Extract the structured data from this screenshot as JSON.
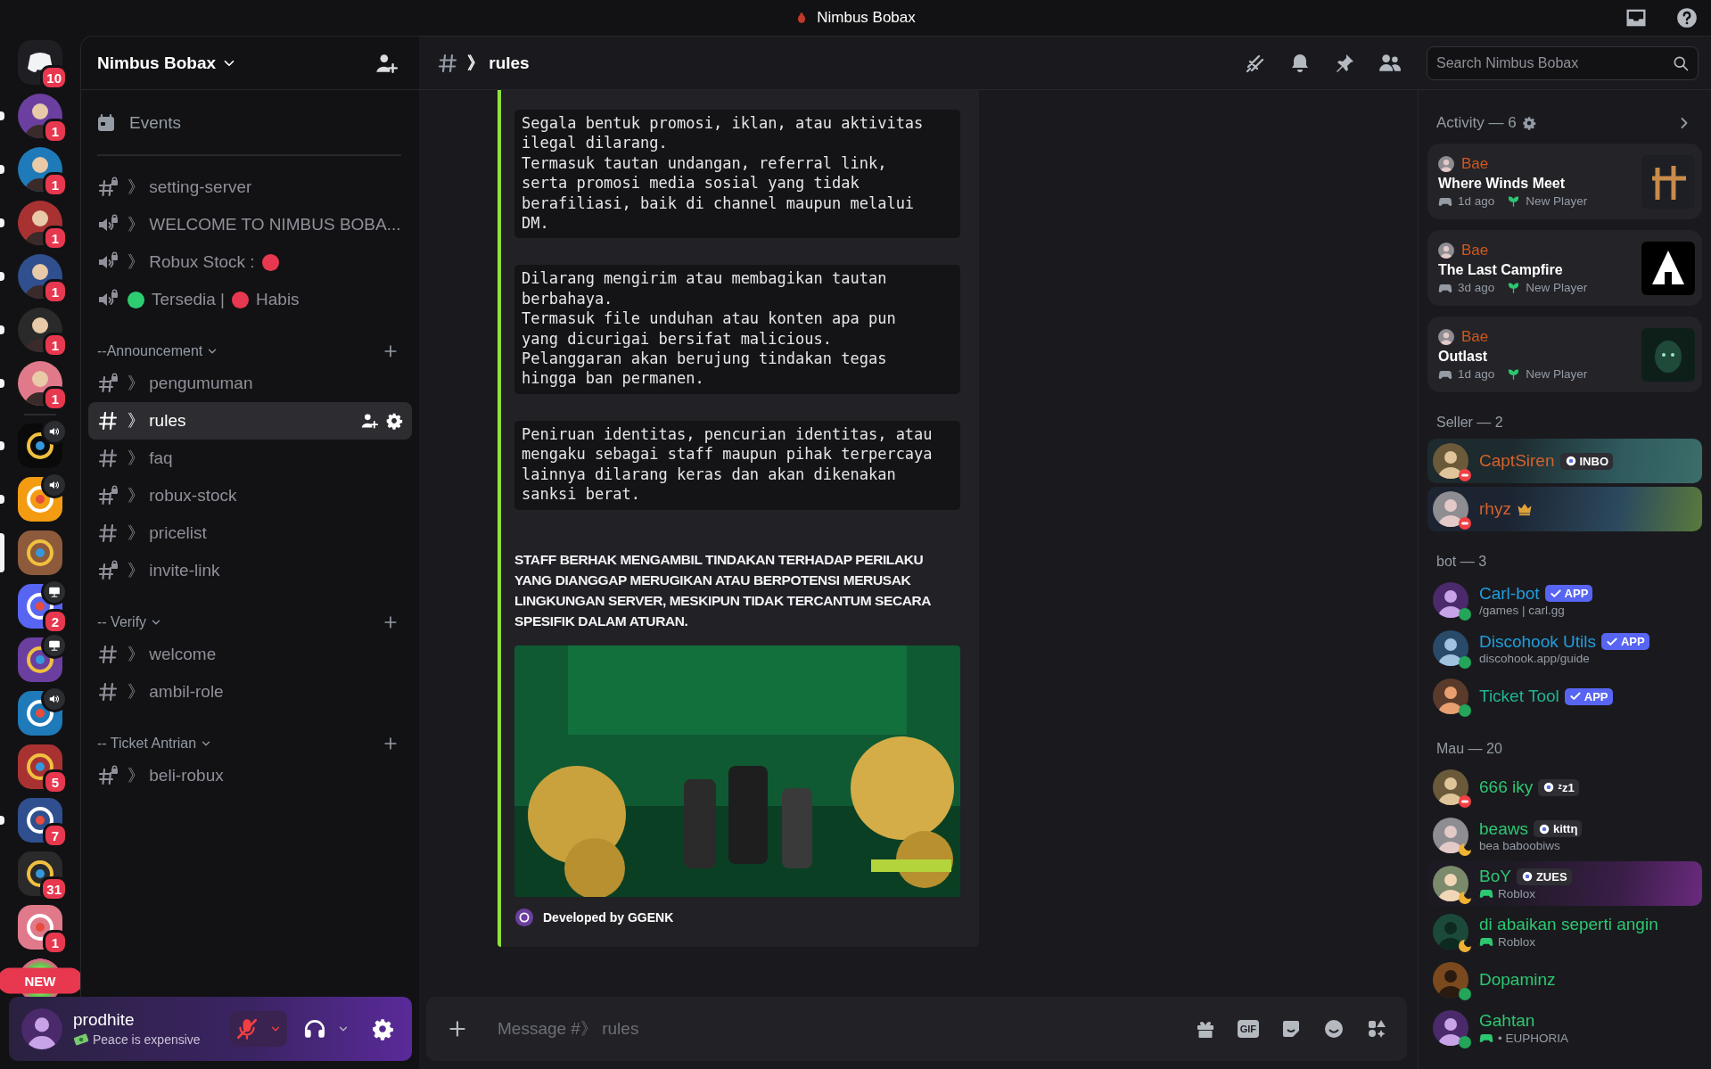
{
  "title_bar": {
    "title": "Nimbus Bobax"
  },
  "servers": [
    {
      "kind": "home",
      "badge": "10",
      "voice": false,
      "streaming": false,
      "unread": false,
      "selected": false
    },
    {
      "kind": "avatar",
      "badge": "1",
      "voice": false,
      "streaming": false,
      "unread": true,
      "selected": false
    },
    {
      "kind": "avatar",
      "badge": "1",
      "voice": false,
      "streaming": false,
      "unread": true,
      "selected": false
    },
    {
      "kind": "avatar",
      "badge": "1",
      "voice": false,
      "streaming": false,
      "unread": true,
      "selected": false
    },
    {
      "kind": "avatar",
      "badge": "1",
      "voice": false,
      "streaming": false,
      "unread": true,
      "selected": false
    },
    {
      "kind": "avatar",
      "badge": "1",
      "voice": false,
      "streaming": false,
      "unread": true,
      "selected": false
    },
    {
      "kind": "avatar",
      "badge": "1",
      "voice": false,
      "streaming": false,
      "unread": true,
      "selected": false
    },
    {
      "kind": "divider"
    },
    {
      "kind": "app",
      "voice": true,
      "streaming": false,
      "unread": true,
      "selected": false
    },
    {
      "kind": "app",
      "voice": true,
      "streaming": false,
      "unread": true,
      "selected": false
    },
    {
      "kind": "app",
      "voice": false,
      "streaming": false,
      "unread": false,
      "selected": true
    },
    {
      "kind": "app",
      "badge": "2",
      "voice": false,
      "streaming": true,
      "unread": false,
      "selected": false
    },
    {
      "kind": "app",
      "voice": false,
      "streaming": true,
      "unread": false,
      "selected": false
    },
    {
      "kind": "app",
      "voice": true,
      "streaming": false,
      "unread": false,
      "selected": false
    },
    {
      "kind": "app",
      "badge": "5",
      "voice": false,
      "streaming": false,
      "unread": false,
      "selected": false
    },
    {
      "kind": "app",
      "badge": "7",
      "voice": false,
      "streaming": false,
      "unread": true,
      "selected": false
    },
    {
      "kind": "app",
      "badge": "31",
      "voice": false,
      "streaming": false,
      "unread": false,
      "selected": false
    },
    {
      "kind": "app",
      "badge": "1",
      "voice": false,
      "streaming": false,
      "unread": false,
      "selected": false
    },
    {
      "kind": "avatar",
      "label": "NEW",
      "voice": false,
      "streaming": false,
      "unread": false,
      "selected": false
    }
  ],
  "sidebar": {
    "server_name": "Nimbus Bobax",
    "events_label": "Events",
    "channels": [
      {
        "kind": "text-locked",
        "parts": [
          {
            "text": "》 setting-server"
          }
        ],
        "selected": false
      },
      {
        "kind": "voice-locked",
        "parts": [
          {
            "text": "》 WELCOME TO NIMBUS BOBA..."
          }
        ],
        "selected": false
      },
      {
        "kind": "voice-locked",
        "parts": [
          {
            "text": "》 Robux Stock :"
          },
          {
            "color": "#e8384f"
          }
        ],
        "selected": false
      },
      {
        "kind": "voice-locked",
        "parts": [
          {
            "color": "#2ecc71"
          },
          {
            "text": "Tersedia |"
          },
          {
            "color": "#e8384f"
          },
          {
            "text": "Habis"
          }
        ],
        "selected": false
      }
    ],
    "categories": [
      {
        "name": "--Announcement",
        "expanded": true,
        "channels": [
          {
            "kind": "text-locked",
            "parts": [
              {
                "text": "》 pengumuman"
              }
            ],
            "selected": false
          },
          {
            "kind": "text",
            "parts": [
              {
                "text": "》 rules"
              }
            ],
            "selected": true
          },
          {
            "kind": "text",
            "parts": [
              {
                "text": "》 faq"
              }
            ],
            "selected": false
          },
          {
            "kind": "text-locked",
            "parts": [
              {
                "text": "》 robux-stock"
              }
            ],
            "selected": false
          },
          {
            "kind": "text",
            "parts": [
              {
                "text": "》 pricelist"
              }
            ],
            "selected": false
          },
          {
            "kind": "text-locked",
            "parts": [
              {
                "text": "》 invite-link"
              }
            ],
            "selected": false
          }
        ]
      },
      {
        "name": "-- Verify",
        "expanded": true,
        "channels": [
          {
            "kind": "text",
            "parts": [
              {
                "text": "》 welcome"
              }
            ],
            "selected": false
          },
          {
            "kind": "text",
            "parts": [
              {
                "text": "》 ambil-role"
              }
            ],
            "selected": false
          }
        ]
      },
      {
        "name": "-- Ticket Antrian",
        "expanded": true,
        "channels": [
          {
            "kind": "text-locked",
            "parts": [
              {
                "text": "》 beli-robux"
              }
            ],
            "selected": false
          }
        ]
      }
    ]
  },
  "user_panel": {
    "username": "prodhite",
    "status": "Peace is expensive",
    "muted": true,
    "deafened": false
  },
  "chat": {
    "channel_name": "》 rules",
    "search_placeholder": "Search Nimbus Bobax",
    "embed": {
      "code_blocks": [
        "Segala bentuk promosi, iklan, atau aktivitas ilegal dilarang.\nTermasuk tautan undangan, referral link, serta promosi media sosial yang tidak berafiliasi, baik di channel maupun melalui DM.",
        "Dilarang mengirim atau membagikan tautan berbahaya.\nTermasuk file unduhan atau konten apa pun yang dicurigai bersifat malicious.\nPelanggaran akan berujung tindakan tegas hingga ban permanen.",
        "Peniruan identitas, pencurian identitas, atau mengaku sebagai staff maupun pihak terpercaya lainnya dilarang keras dan akan dikenakan sanksi berat."
      ],
      "notice": "STAFF BERHAK MENGAMBIL TINDAKAN TERHADAP PERILAKU YANG DIANGGAP MERUGIKAN ATAU BERPOTENSI MERUSAK LINGKUNGAN SERVER, MESKIPUN TIDAK TERCANTUM SECARA SPESIFIK DALAM ATURAN.",
      "footer": "Developed by GGENK"
    },
    "composer": {
      "placeholder": "Message #》 rules",
      "gif_label": "GIF"
    }
  },
  "members": {
    "activity": {
      "title": "Activity — 6",
      "items": [
        {
          "user": "Bae",
          "game": "Where Winds Meet",
          "time": "1d ago",
          "tag": "New Player"
        },
        {
          "user": "Bae",
          "game": "The Last Campfire",
          "time": "3d ago",
          "tag": "New Player"
        },
        {
          "user": "Bae",
          "game": "Outlast",
          "time": "1d ago",
          "tag": "New Player"
        }
      ]
    },
    "groups": [
      {
        "title": "Seller — 2",
        "members": [
          {
            "name": "CaptSiren",
            "color": "#d5622b",
            "tag": {
              "kind": "guild",
              "text": "INBO"
            },
            "dnd": true,
            "idle": false,
            "banner": true,
            "crown": false,
            "playing": false
          },
          {
            "name": "rhyz",
            "color": "#d5622b",
            "dnd": true,
            "idle": false,
            "banner": true,
            "crown": true,
            "playing": false
          }
        ]
      },
      {
        "title": "bot — 3",
        "members": [
          {
            "name": "Carl-bot",
            "color": "#1f9ede",
            "tag": {
              "kind": "app",
              "text": "APP"
            },
            "subtitle": "/games | carl.gg",
            "dnd": false,
            "idle": false,
            "banner": false,
            "crown": false,
            "playing": false
          },
          {
            "name": "Discohook Utils",
            "color": "#1f9ede",
            "tag": {
              "kind": "app",
              "text": "APP"
            },
            "subtitle": "discohook.app/guide",
            "dnd": false,
            "idle": false,
            "banner": false,
            "crown": false,
            "playing": false
          },
          {
            "name": "Ticket Tool",
            "color": "#1fb594",
            "tag": {
              "kind": "app",
              "text": "APP"
            },
            "dnd": false,
            "idle": false,
            "banner": false,
            "crown": false,
            "playing": false
          }
        ]
      },
      {
        "title": "Mau — 20",
        "members": [
          {
            "name": "666 iky",
            "color": "#2dc771",
            "tag": {
              "kind": "guild",
              "text": "ᶻz1"
            },
            "dnd": true,
            "idle": false,
            "banner": false,
            "crown": false,
            "playing": false
          },
          {
            "name": "beaws",
            "color": "#2dc771",
            "tag": {
              "kind": "guild",
              "text": "kittη"
            },
            "subtitle": "bea baboobiws",
            "dnd": false,
            "idle": true,
            "banner": false,
            "crown": false,
            "playing": false
          },
          {
            "name": "BoY",
            "color": "#2dc771",
            "tag": {
              "kind": "guild",
              "text": "ZUES"
            },
            "subtitle": "Roblox",
            "dnd": false,
            "idle": true,
            "banner": true,
            "crown": false,
            "playing": true
          },
          {
            "name": "di abaikan seperti angin",
            "color": "#2dc771",
            "subtitle": "Roblox",
            "dnd": false,
            "idle": true,
            "banner": false,
            "crown": false,
            "playing": true
          },
          {
            "name": "Dopaminz",
            "color": "#2dc771",
            "dnd": false,
            "idle": false,
            "banner": false,
            "crown": false,
            "playing": false
          },
          {
            "name": "Gahtan",
            "color": "#2dc771",
            "subtitle": "• EUPHORIA",
            "dnd": false,
            "idle": false,
            "banner": false,
            "crown": false,
            "playing": true
          }
        ]
      }
    ]
  }
}
